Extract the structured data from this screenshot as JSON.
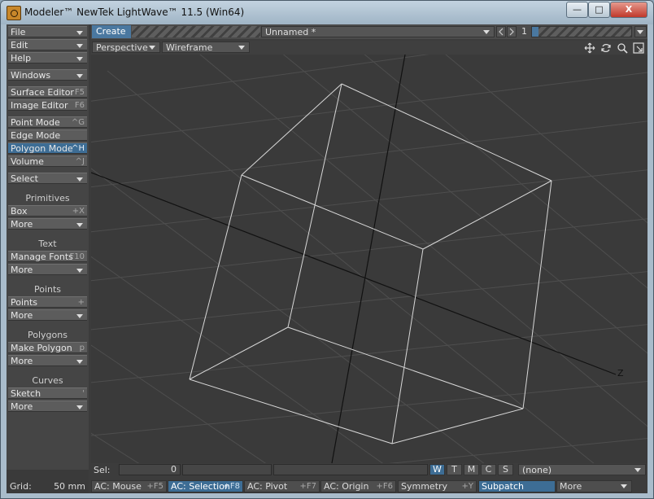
{
  "window": {
    "title": "Modeler™ NewTek LightWave™ 11.5 (Win64)",
    "controls": {
      "minimize": "—",
      "maximize": "□",
      "close": "X"
    }
  },
  "sidebar": {
    "file": "File",
    "edit": "Edit",
    "help": "Help",
    "windows": "Windows",
    "surface_editor": {
      "label": "Surface Editor",
      "shortcut": "F5"
    },
    "image_editor": {
      "label": "Image Editor",
      "shortcut": "F6"
    },
    "point_mode": {
      "label": "Point Mode",
      "shortcut": "^G"
    },
    "edge_mode": {
      "label": "Edge Mode",
      "shortcut": ""
    },
    "polygon_mode": {
      "label": "Polygon Mode",
      "shortcut": "^H",
      "selected": true
    },
    "volume": {
      "label": "Volume",
      "shortcut": "^J"
    },
    "select": "Select",
    "sections": [
      {
        "heading": "Primitives",
        "tool": "Box",
        "shortcut": "+X",
        "more": "More"
      },
      {
        "heading": "Text",
        "tool": "Manage Fonts",
        "shortcut": "F10",
        "more": "More"
      },
      {
        "heading": "Points",
        "tool": "Points",
        "shortcut": "+",
        "more": "More"
      },
      {
        "heading": "Polygons",
        "tool": "Make Polygon",
        "shortcut": "p",
        "more": "More"
      },
      {
        "heading": "Curves",
        "tool": "Sketch",
        "shortcut": "'",
        "more": "More"
      }
    ],
    "grid_label": "Grid:",
    "grid_value": "50 mm"
  },
  "toolbar": {
    "tab_create": "Create",
    "object_name": "Unnamed *",
    "layer_number": "1"
  },
  "viewport": {
    "view": "Perspective",
    "render_mode": "Wireframe",
    "axis_label": "Z"
  },
  "status": {
    "sel_label": "Sel:",
    "sel_value": "0",
    "toggles": [
      {
        "label": "W",
        "on": true
      },
      {
        "label": "T",
        "on": false
      },
      {
        "label": "M",
        "on": false
      },
      {
        "label": "C",
        "on": false
      },
      {
        "label": "S",
        "on": false
      }
    ],
    "surface": "(none)"
  },
  "actions": {
    "mouse": {
      "label": "AC: Mouse",
      "shortcut": "+F5"
    },
    "selection": {
      "label": "AC: Selection",
      "shortcut": "+F8"
    },
    "pivot": {
      "label": "AC: Pivot",
      "shortcut": "+F7"
    },
    "origin": {
      "label": "AC: Origin",
      "shortcut": "+F6"
    },
    "symmetry": {
      "label": "Symmetry",
      "shortcut": "+Y"
    },
    "subpatch": "Subpatch",
    "more": "More"
  },
  "colors": {
    "accent": "#3d6d95",
    "panel": "#454545",
    "viewport": "#3a3a3a"
  }
}
